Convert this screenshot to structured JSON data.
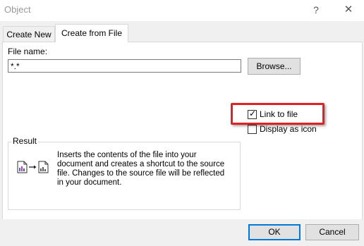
{
  "window": {
    "title": "Object",
    "help_glyph": "?",
    "close_glyph": "✕"
  },
  "tabs": [
    {
      "label": "Create New"
    },
    {
      "label": "Create from File"
    }
  ],
  "file": {
    "label": "File name:",
    "value": "*.*",
    "browse_label": "Browse..."
  },
  "options": {
    "link_to_file_label": "Link to file",
    "link_to_file_checked": true,
    "display_as_icon_label": "Display as icon",
    "display_as_icon_checked": false,
    "check_glyph": "✓"
  },
  "result": {
    "legend": "Result",
    "text": "Inserts the contents of the file into your document and creates a shortcut to the source file.  Changes to the source file will be reflected in your document."
  },
  "footer": {
    "ok_label": "OK",
    "cancel_label": "Cancel"
  },
  "colors": {
    "highlight": "#e52020",
    "default_button_border": "#0078d7"
  }
}
